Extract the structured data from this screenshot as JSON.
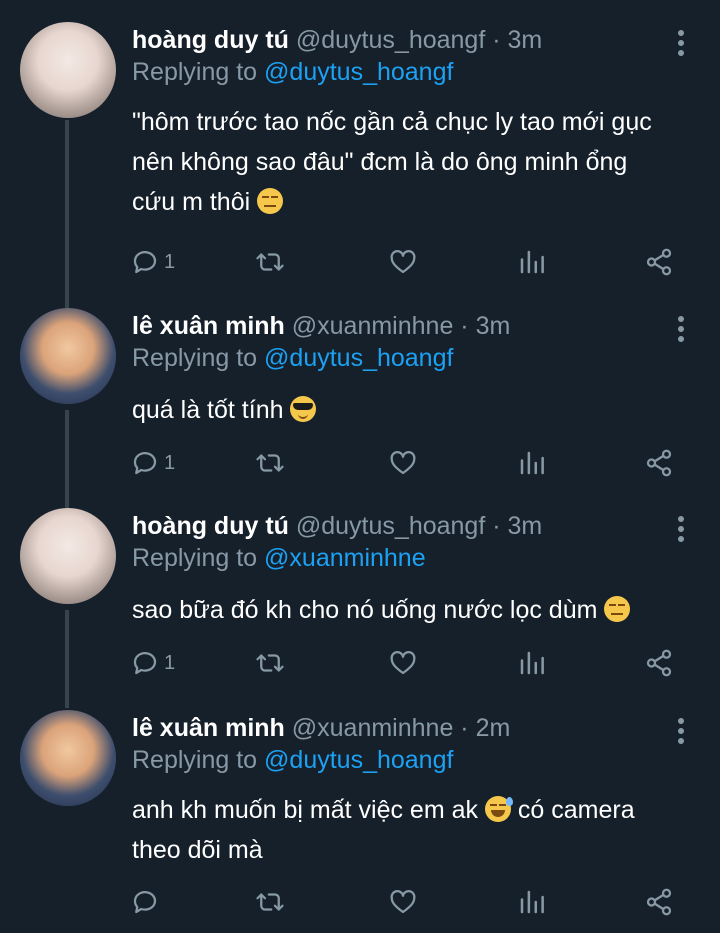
{
  "tweets": [
    {
      "name": "hoàng duy tú",
      "handle": "@duytus_hoangf",
      "sep": " · ",
      "time": "3m",
      "replying_prefix": "Replying to ",
      "replying_to": "@duytus_hoangf",
      "text_lines": [
        "\"hôm trước tao nốc gần cả chục ly tao mới gục",
        "nên không sao đâu\" đcm là do ông minh ổng",
        "cứu m thôi"
      ],
      "emoji": "expressionless",
      "reply_count": "1"
    },
    {
      "name": "lê xuân minh",
      "handle": "@xuanminhne",
      "sep": " · ",
      "time": "3m",
      "replying_prefix": "Replying to ",
      "replying_to": "@duytus_hoangf",
      "text_lines": [
        "quá là tốt tính"
      ],
      "emoji": "sunglasses",
      "reply_count": "1"
    },
    {
      "name": "hoàng duy tú",
      "handle": "@duytus_hoangf",
      "sep": " · ",
      "time": "3m",
      "replying_prefix": "Replying to ",
      "replying_to": "@xuanminhne",
      "text_lines": [
        "sao bữa đó kh cho nó uống nước lọc dùm"
      ],
      "emoji": "expressionless",
      "reply_count": "1"
    },
    {
      "name": "lê xuân minh",
      "handle": "@xuanminhne",
      "sep": " · ",
      "time": "2m",
      "replying_prefix": "Replying to ",
      "replying_to": "@duytus_hoangf",
      "text_line1_a": "anh kh muốn bị mất việc em ak ",
      "text_line1_b": " có camera",
      "text_line2": "theo dõi mà",
      "emoji": "sweat-smile",
      "reply_count": ""
    }
  ],
  "icons": [
    "reply-icon",
    "retweet-icon",
    "like-icon",
    "analytics-icon",
    "share-icon",
    "more-icon"
  ],
  "colors": {
    "background": "#15202b",
    "text": "#ffffff",
    "muted": "#8899a6",
    "mention": "#1da1f2",
    "thread": "#38444d"
  }
}
